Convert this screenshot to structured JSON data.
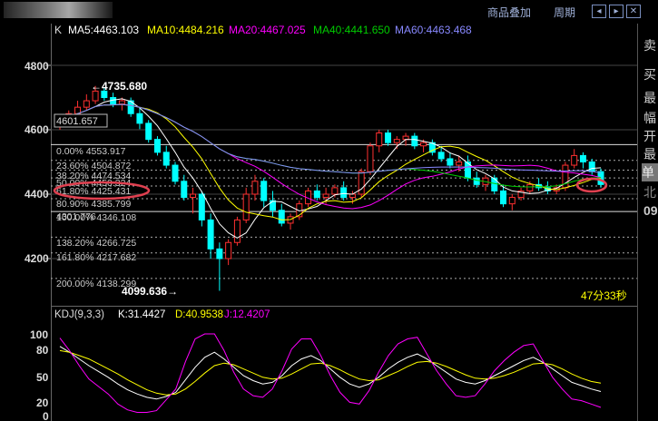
{
  "toolbar": {
    "overlay_label": "商品叠加",
    "period_label": "周期",
    "icons": [
      "scroll-left-icon",
      "scroll-right-icon"
    ]
  },
  "right_panel": {
    "items": [
      "卖",
      "买",
      "最",
      "幅",
      "开",
      "最",
      "单",
      "北",
      "09"
    ]
  },
  "main_legend": {
    "prefix": "K",
    "items": [
      {
        "label": "MA5:4463.103",
        "color": "#ffffff"
      },
      {
        "label": "MA10:4484.216",
        "color": "#ffff00"
      },
      {
        "label": "MA20:4467.025",
        "color": "#ff00ff"
      },
      {
        "label": "MA40:4441.650",
        "color": "#00cc00"
      },
      {
        "label": "MA60:4463.468",
        "color": "#8888ff"
      }
    ]
  },
  "price_axis": [
    "4800",
    "4600",
    "4400",
    "4200"
  ],
  "fib_levels": [
    {
      "label": "0.00% 4553.917",
      "value": 4553.917
    },
    {
      "label": "23.60% 4504.872",
      "value": 4504.872
    },
    {
      "label": "38.20% 4474.534",
      "value": 4474.534
    },
    {
      "label": "50.00% 4450.324",
      "value": 4450.324
    },
    {
      "label": "61.80% 4425.431",
      "value": 4425.431
    },
    {
      "label": "80.90% 4385.799",
      "value": 4385.799
    },
    {
      "label": "100.00% 4346.108",
      "value": 4346.108
    },
    {
      "label": "138.20% 4266.725",
      "value": 4266.725
    },
    {
      "label": "161.80% 4217.682",
      "value": 4217.682
    },
    {
      "label": "200.00% 4138.299",
      "value": 4138.299
    }
  ],
  "fib_overlap_label": "4301.776",
  "annotations": {
    "high": "4735.680",
    "box_value": "4601.657",
    "low": "4099.636",
    "timer": "47分33秒"
  },
  "highlight_color": "#e04050",
  "kdj_legend": {
    "prefix": "KDJ(9,3,3)",
    "items": [
      {
        "label": "K:31.4427",
        "color": "#ffffff"
      },
      {
        "label": "D:40.9538",
        "color": "#ffff00"
      },
      {
        "label": "J:12.4207",
        "color": "#ff00ff"
      }
    ]
  },
  "kdj_axis": [
    "100",
    "80",
    "50",
    "20",
    "0"
  ],
  "chart_data": {
    "type": "candlestick",
    "ylim": [
      4060,
      4880
    ],
    "candles_approx": [
      [
        4620,
        4640,
        4600,
        4630
      ],
      [
        4630,
        4660,
        4615,
        4650
      ],
      [
        4650,
        4690,
        4640,
        4670
      ],
      [
        4670,
        4710,
        4660,
        4690
      ],
      [
        4690,
        4736,
        4680,
        4720
      ],
      [
        4720,
        4730,
        4690,
        4700
      ],
      [
        4700,
        4715,
        4670,
        4680
      ],
      [
        4680,
        4700,
        4660,
        4690
      ],
      [
        4690,
        4700,
        4640,
        4650
      ],
      [
        4650,
        4670,
        4602,
        4620
      ],
      [
        4620,
        4630,
        4560,
        4570
      ],
      [
        4570,
        4580,
        4520,
        4530
      ],
      [
        4530,
        4550,
        4480,
        4490
      ],
      [
        4490,
        4500,
        4430,
        4440
      ],
      [
        4440,
        4460,
        4380,
        4390
      ],
      [
        4390,
        4420,
        4340,
        4400
      ],
      [
        4400,
        4410,
        4300,
        4320
      ],
      [
        4320,
        4340,
        4200,
        4230
      ],
      [
        4230,
        4250,
        4100,
        4200
      ],
      [
        4200,
        4260,
        4180,
        4250
      ],
      [
        4250,
        4330,
        4240,
        4320
      ],
      [
        4320,
        4420,
        4310,
        4400
      ],
      [
        4400,
        4460,
        4380,
        4440
      ],
      [
        4440,
        4450,
        4360,
        4380
      ],
      [
        4380,
        4410,
        4330,
        4350
      ],
      [
        4350,
        4370,
        4300,
        4310
      ],
      [
        4310,
        4340,
        4290,
        4330
      ],
      [
        4330,
        4380,
        4320,
        4370
      ],
      [
        4370,
        4420,
        4360,
        4410
      ],
      [
        4410,
        4430,
        4380,
        4390
      ],
      [
        4390,
        4420,
        4370,
        4400
      ],
      [
        4400,
        4430,
        4390,
        4420
      ],
      [
        4420,
        4440,
        4380,
        4390
      ],
      [
        4390,
        4410,
        4370,
        4400
      ],
      [
        4400,
        4480,
        4390,
        4470
      ],
      [
        4470,
        4560,
        4460,
        4550
      ],
      [
        4550,
        4600,
        4530,
        4590
      ],
      [
        4590,
        4600,
        4550,
        4560
      ],
      [
        4560,
        4580,
        4540,
        4570
      ],
      [
        4570,
        4590,
        4550,
        4580
      ],
      [
        4580,
        4590,
        4540,
        4550
      ],
      [
        4550,
        4570,
        4530,
        4560
      ],
      [
        4560,
        4570,
        4520,
        4530
      ],
      [
        4530,
        4550,
        4500,
        4510
      ],
      [
        4510,
        4530,
        4480,
        4490
      ],
      [
        4490,
        4520,
        4470,
        4500
      ],
      [
        4500,
        4520,
        4440,
        4450
      ],
      [
        4450,
        4470,
        4420,
        4430
      ],
      [
        4430,
        4460,
        4410,
        4450
      ],
      [
        4450,
        4460,
        4400,
        4410
      ],
      [
        4410,
        4430,
        4360,
        4370
      ],
      [
        4370,
        4400,
        4350,
        4390
      ],
      [
        4390,
        4420,
        4380,
        4410
      ],
      [
        4410,
        4440,
        4400,
        4430
      ],
      [
        4430,
        4450,
        4410,
        4420
      ],
      [
        4420,
        4440,
        4400,
        4410
      ],
      [
        4410,
        4430,
        4400,
        4420
      ],
      [
        4420,
        4500,
        4410,
        4490
      ],
      [
        4490,
        4540,
        4480,
        4520
      ],
      [
        4520,
        4530,
        4480,
        4500
      ],
      [
        4500,
        4510,
        4460,
        4470
      ],
      [
        4470,
        4480,
        4420,
        4430
      ]
    ],
    "kdj": {
      "K": [
        85,
        78,
        70,
        62,
        55,
        48,
        40,
        33,
        28,
        24,
        22,
        25,
        30,
        45,
        60,
        72,
        78,
        70,
        60,
        50,
        44,
        40,
        42,
        50,
        62,
        70,
        74,
        68,
        58,
        48,
        40,
        36,
        40,
        48,
        58,
        66,
        72,
        76,
        70,
        62,
        54,
        46,
        42,
        40,
        44,
        50,
        56,
        62,
        68,
        72,
        66,
        58,
        50,
        42,
        38,
        34,
        31
      ],
      "D": [
        80,
        78,
        74,
        70,
        64,
        58,
        52,
        45,
        39,
        33,
        29,
        27,
        28,
        34,
        43,
        53,
        62,
        65,
        63,
        58,
        53,
        48,
        46,
        47,
        52,
        58,
        64,
        65,
        62,
        57,
        51,
        46,
        44,
        45,
        50,
        55,
        61,
        66,
        67,
        65,
        61,
        56,
        51,
        47,
        46,
        47,
        50,
        54,
        59,
        64,
        65,
        63,
        58,
        52,
        47,
        43,
        41
      ],
      "J": [
        95,
        80,
        62,
        46,
        37,
        28,
        16,
        9,
        6,
        6,
        8,
        21,
        34,
        67,
        94,
        100,
        100,
        80,
        54,
        34,
        26,
        24,
        34,
        56,
        82,
        94,
        94,
        74,
        50,
        30,
        18,
        16,
        32,
        54,
        74,
        88,
        94,
        96,
        76,
        56,
        40,
        26,
        24,
        26,
        40,
        56,
        68,
        78,
        86,
        88,
        68,
        48,
        34,
        22,
        20,
        16,
        12
      ]
    }
  }
}
